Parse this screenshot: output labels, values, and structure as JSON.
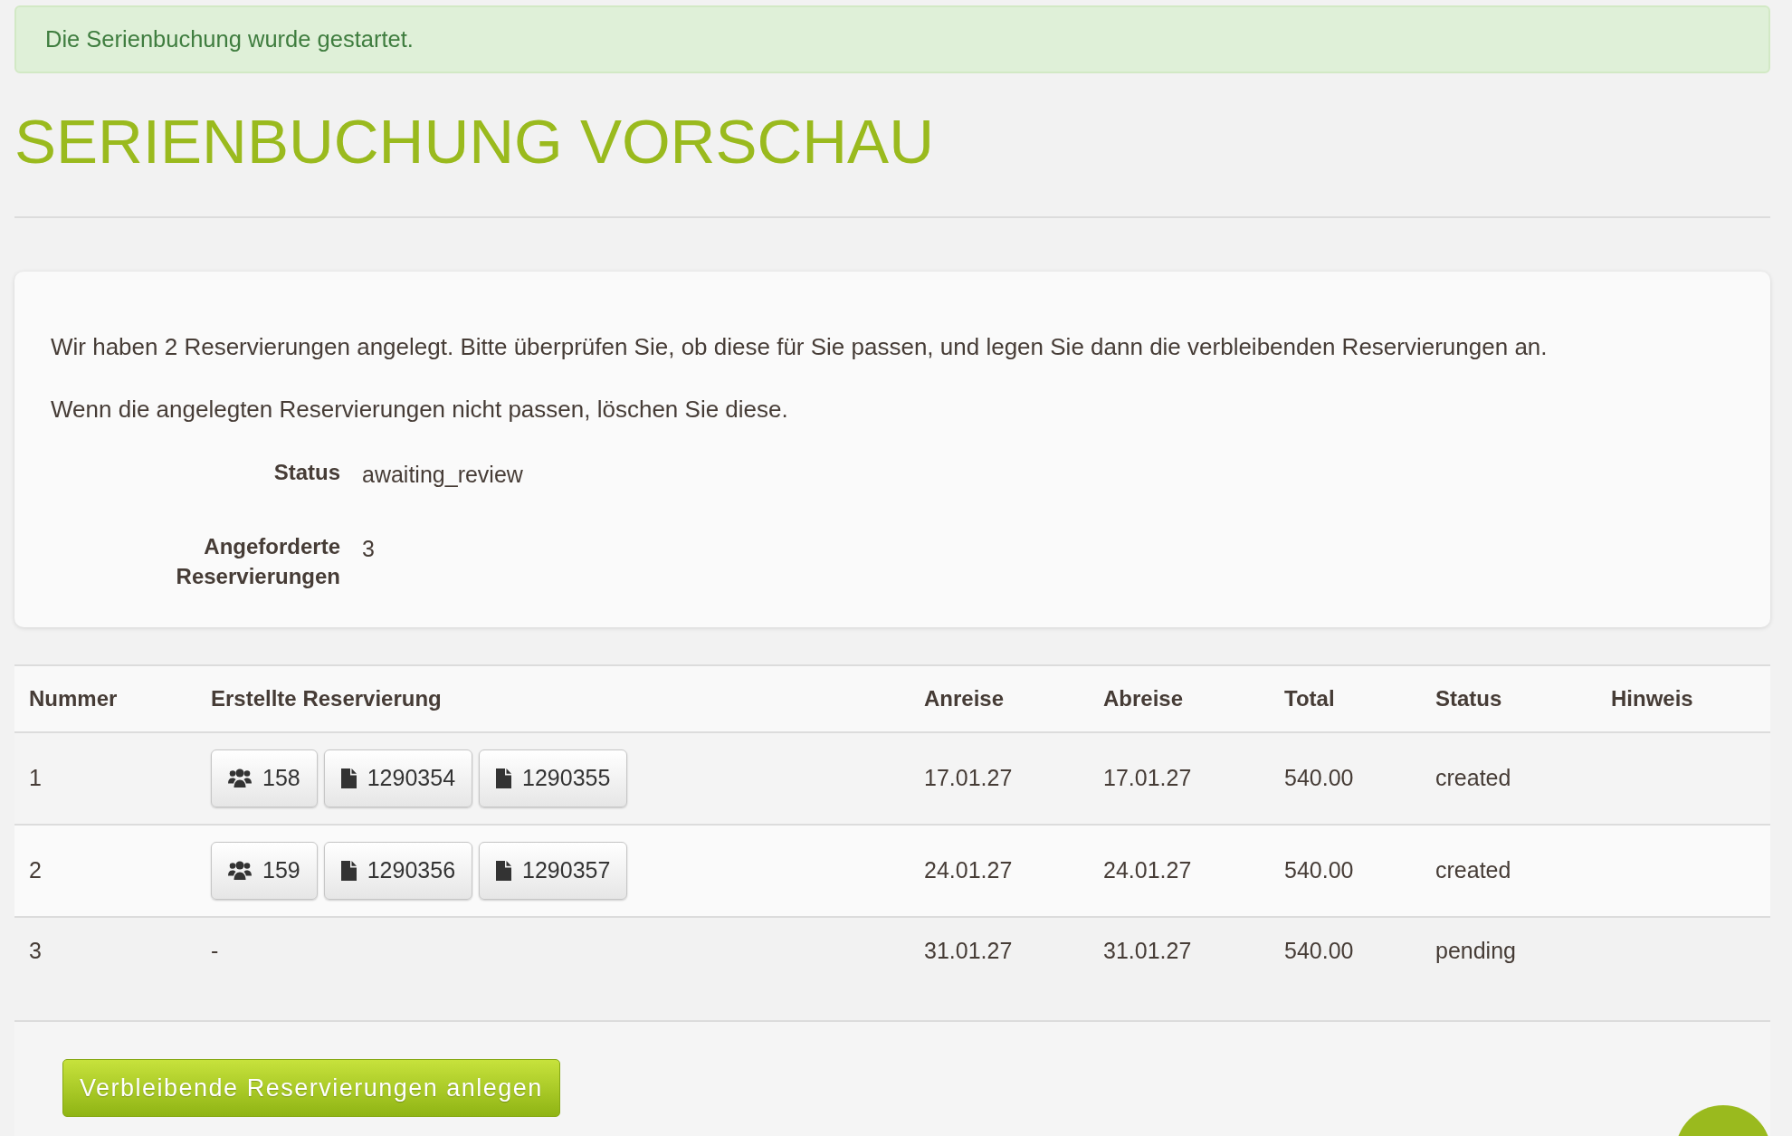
{
  "alert": "Die Serienbuchung wurde gestartet.",
  "title": "SERIENBUCHUNG VORSCHAU",
  "summary": {
    "paragraphs": [
      "Wir haben 2 Reservierungen angelegt. Bitte überprüfen Sie, ob diese für Sie passen, und legen Sie dann die verbleibenden Reservierungen an.",
      "Wenn die angelegten Reservierungen nicht passen, löschen Sie diese."
    ],
    "fields": [
      {
        "label": "Status",
        "value": "awaiting_review"
      },
      {
        "label": "Angeforderte Reservierungen",
        "value": "3"
      }
    ]
  },
  "table": {
    "columns": [
      "Nummer",
      "Erstellte Reservierung",
      "Anreise",
      "Abreise",
      "Total",
      "Status",
      "Hinweis"
    ],
    "rows": [
      {
        "number": "1",
        "reservations": [
          {
            "kind": "group",
            "label": "158"
          },
          {
            "kind": "document",
            "label": "1290354"
          },
          {
            "kind": "document",
            "label": "1290355"
          }
        ],
        "arrival": "17.01.27",
        "departure": "17.01.27",
        "total": "540.00",
        "status": "created"
      },
      {
        "number": "2",
        "reservations": [
          {
            "kind": "group",
            "label": "159"
          },
          {
            "kind": "document",
            "label": "1290356"
          },
          {
            "kind": "document",
            "label": "1290357"
          }
        ],
        "arrival": "24.01.27",
        "departure": "24.01.27",
        "total": "540.00",
        "status": "created"
      },
      {
        "number": "3",
        "reservation_text": "-",
        "arrival": "31.01.27",
        "departure": "31.01.27",
        "total": "540.00",
        "status": "pending"
      }
    ]
  },
  "primary_button": "Verbleibende Reservierungen anlegen"
}
